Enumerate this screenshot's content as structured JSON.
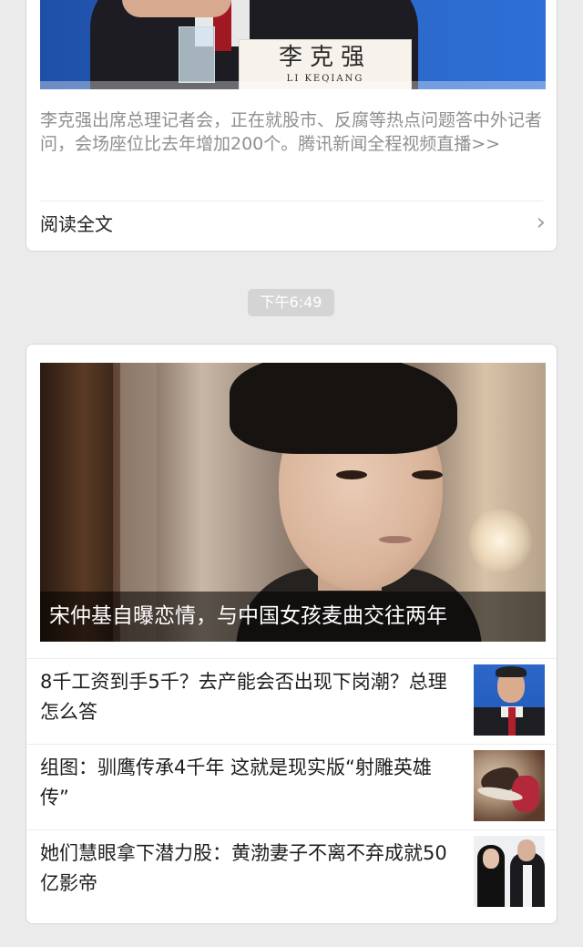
{
  "card1": {
    "hero_nameplate": "李克强",
    "hero_nameplate_pinyin": "LI KEQIANG",
    "summary": "李克强出席总理记者会，正在就股市、反腐等热点问题答中外记者问，会场座位比去年增加200个。腾讯新闻全程视频直播>>",
    "read_more_label": "阅读全文",
    "chevron_icon": "chevron-right-icon"
  },
  "timestamp": "下午6:49",
  "card2": {
    "hero_caption": "宋仲基自曝恋情，与中国女孩麦曲交往两年",
    "items": [
      {
        "title": "8千工资到手5千？去产能会否出现下岗潮？总理怎么答"
      },
      {
        "title": "组图：驯鹰传承4千年 这就是现实版“射雕英雄传”"
      },
      {
        "title": "她们慧眼拿下潜力股：黄渤妻子不离不弃成就50亿影帝"
      }
    ]
  }
}
